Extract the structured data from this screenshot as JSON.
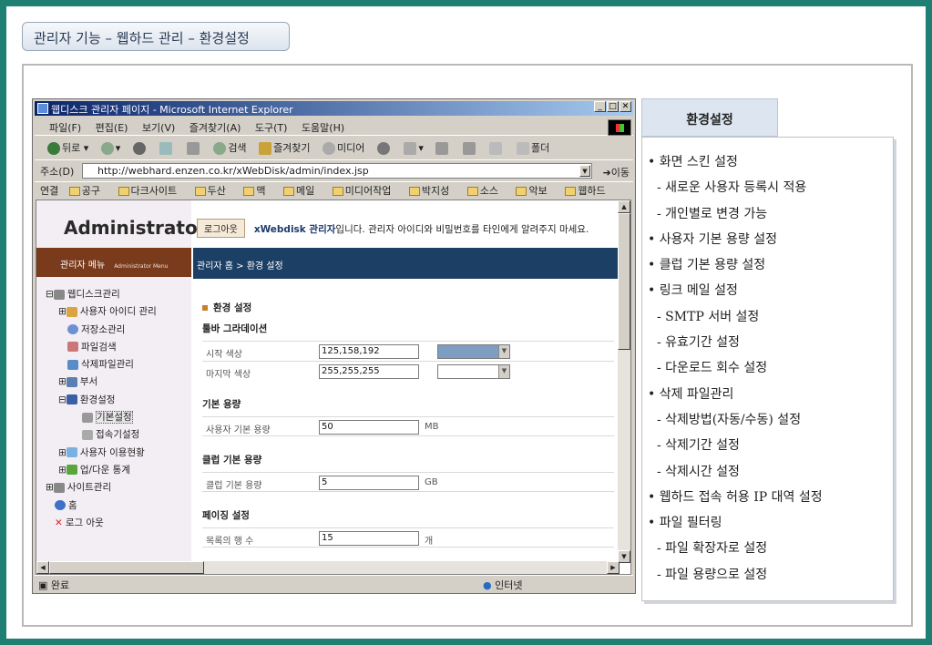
{
  "page_title": "관리자 기능 – 웹하드 관리 – 환경설정",
  "browser": {
    "title": "웹디스크 관리자 페이지 - Microsoft Internet Explorer",
    "menu": [
      "파일(F)",
      "편집(E)",
      "보기(V)",
      "즐겨찾기(A)",
      "도구(T)",
      "도움말(H)"
    ],
    "toolbar": {
      "back": "뒤로",
      "search": "검색",
      "favorites": "즐겨찾기",
      "media": "미디어",
      "folder": "폴더"
    },
    "address_label": "주소(D)",
    "address": "http://webhard.enzen.co.kr/xWebDisk/admin/index.jsp",
    "go": "이동",
    "links_label": "연결",
    "links": [
      "공구",
      "다크사이트",
      "두산",
      "맥",
      "메일",
      "미디어작업",
      "박지성",
      "소스",
      "악보",
      "웹하드"
    ],
    "status": "완료",
    "zone": "인터넷"
  },
  "admin": {
    "logo": "Administrator",
    "menu_label": "관리자 메뉴",
    "menu_sub": "Administrator Menu",
    "tree": [
      "웹디스크관리",
      "사용자 아이디 관리",
      "저장소관리",
      "파일검색",
      "삭제파일관리",
      "부서",
      "환경설정",
      "기본설정",
      "접속기설정",
      "사용자 이용현황",
      "업/다운 통계",
      "사이트관리",
      "홈",
      "로그 아웃"
    ]
  },
  "content": {
    "logout": "로그아웃",
    "greeting_name": "xWebdisk 관리자",
    "greeting_text": "입니다. 관리자 아이디와 비밀번호를 타인에게 알려주지 마세요.",
    "breadcrumb": "관리자 홈 > 환경 설정",
    "section_title": "환경 설정",
    "toolbar_gradient": "툴바 그라데이션",
    "start_color_label": "시작 색상",
    "start_color_value": "125,158,192",
    "start_color_hex": "#7d9ec0",
    "end_color_label": "마지막 색상",
    "end_color_value": "255,255,255",
    "end_color_hex": "#ffffff",
    "basic_capacity": "기본 용량",
    "user_capacity_label": "사용자 기본 용량",
    "user_capacity_value": "50",
    "user_capacity_unit": "MB",
    "club_capacity": "클럽 기본 용량",
    "club_capacity_label": "클럽 기본 용량",
    "club_capacity_value": "5",
    "club_capacity_unit": "GB",
    "paging": "페이징 설정",
    "rows_label": "목록의 행 수",
    "rows_value": "15",
    "rows_unit": "개"
  },
  "panel": {
    "tab": "환경설정",
    "items": [
      "• 화면 스킨 설정",
      "- 새로운 사용자 등록시 적용",
      "- 개인별로 변경 가능",
      "• 사용자 기본 용량 설정",
      "• 클럽 기본 용량 설정",
      "• 링크 메일 설정",
      "- SMTP 서버 설정",
      "- 유효기간 설정",
      "- 다운로드 회수 설정",
      "• 삭제 파일관리",
      "- 삭제방법(자동/수동) 설정",
      "- 삭제기간 설정",
      "- 삭제시간 설정",
      "• 웹하드 접속 허용 IP 대역 설정",
      "• 파일 필터링",
      "- 파일 확장자로 설정",
      "- 파일 용량으로 설정"
    ]
  }
}
